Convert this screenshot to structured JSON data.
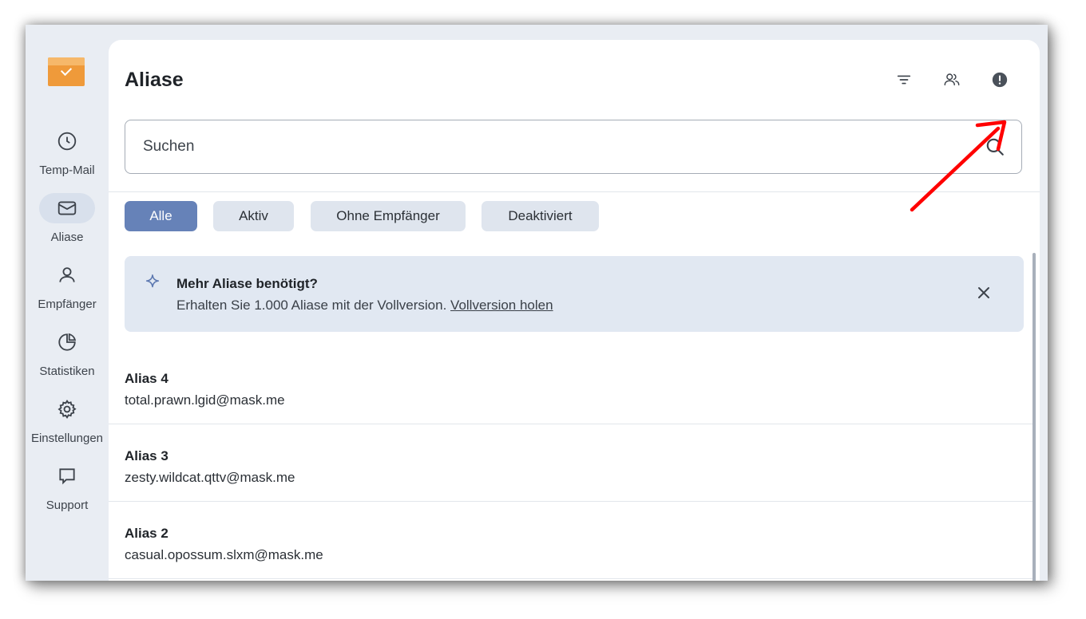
{
  "sidebar": {
    "items": [
      {
        "label": "Temp-Mail",
        "icon": "clock-icon"
      },
      {
        "label": "Aliase",
        "icon": "mail-icon",
        "active": true
      },
      {
        "label": "Empfänger",
        "icon": "user-icon"
      },
      {
        "label": "Statistiken",
        "icon": "pie-chart-icon"
      },
      {
        "label": "Einstellungen",
        "icon": "gear-icon"
      },
      {
        "label": "Support",
        "icon": "chat-icon"
      }
    ]
  },
  "header": {
    "title": "Aliase",
    "icons": [
      "filter-icon",
      "users-icon",
      "info-alert-icon"
    ]
  },
  "search": {
    "placeholder": "Suchen",
    "value": ""
  },
  "filters": [
    {
      "label": "Alle",
      "active": true
    },
    {
      "label": "Aktiv",
      "active": false
    },
    {
      "label": "Ohne Empfänger",
      "active": false
    },
    {
      "label": "Deaktiviert",
      "active": false
    }
  ],
  "banner": {
    "title": "Mehr Aliase benötigt?",
    "text": "Erhalten Sie 1.000 Aliase mit der Vollversion.",
    "link": "Vollversion holen"
  },
  "aliases": [
    {
      "name": "Alias 4",
      "email": "total.prawn.lgid@mask.me"
    },
    {
      "name": "Alias 3",
      "email": "zesty.wildcat.qttv@mask.me"
    },
    {
      "name": "Alias 2",
      "email": "casual.opossum.slxm@mask.me"
    }
  ],
  "colors": {
    "accent": "#6682b8",
    "chip": "#dfe5ee",
    "banner": "#e1e8f2",
    "sidebar": "#e9edf3",
    "logo": "#ef9a3a",
    "annotation_arrow": "#ff0000"
  }
}
